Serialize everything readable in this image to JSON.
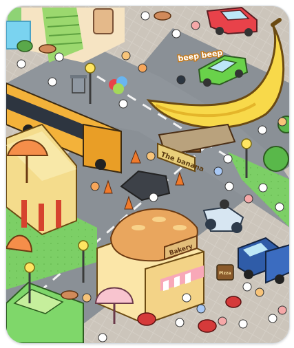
{
  "scene": {
    "labels": {
      "beep_text": "beep beep",
      "banana_sign": "The banana",
      "bakery_sign": "Bakery",
      "small_sign": "Pizza"
    }
  },
  "colors": {
    "road": "#8a9096",
    "sidewalk": "#cfc9c1",
    "grass": "#79cd63",
    "banana": "#f8d94a",
    "bus": "#f3b23a",
    "bakery_wall": "#fbe6a8",
    "bakery_roof_bread": "#e9a65e",
    "red_car": "#e8424a",
    "green_car": "#69d24a",
    "blue_truck": "#2f5ca8"
  }
}
